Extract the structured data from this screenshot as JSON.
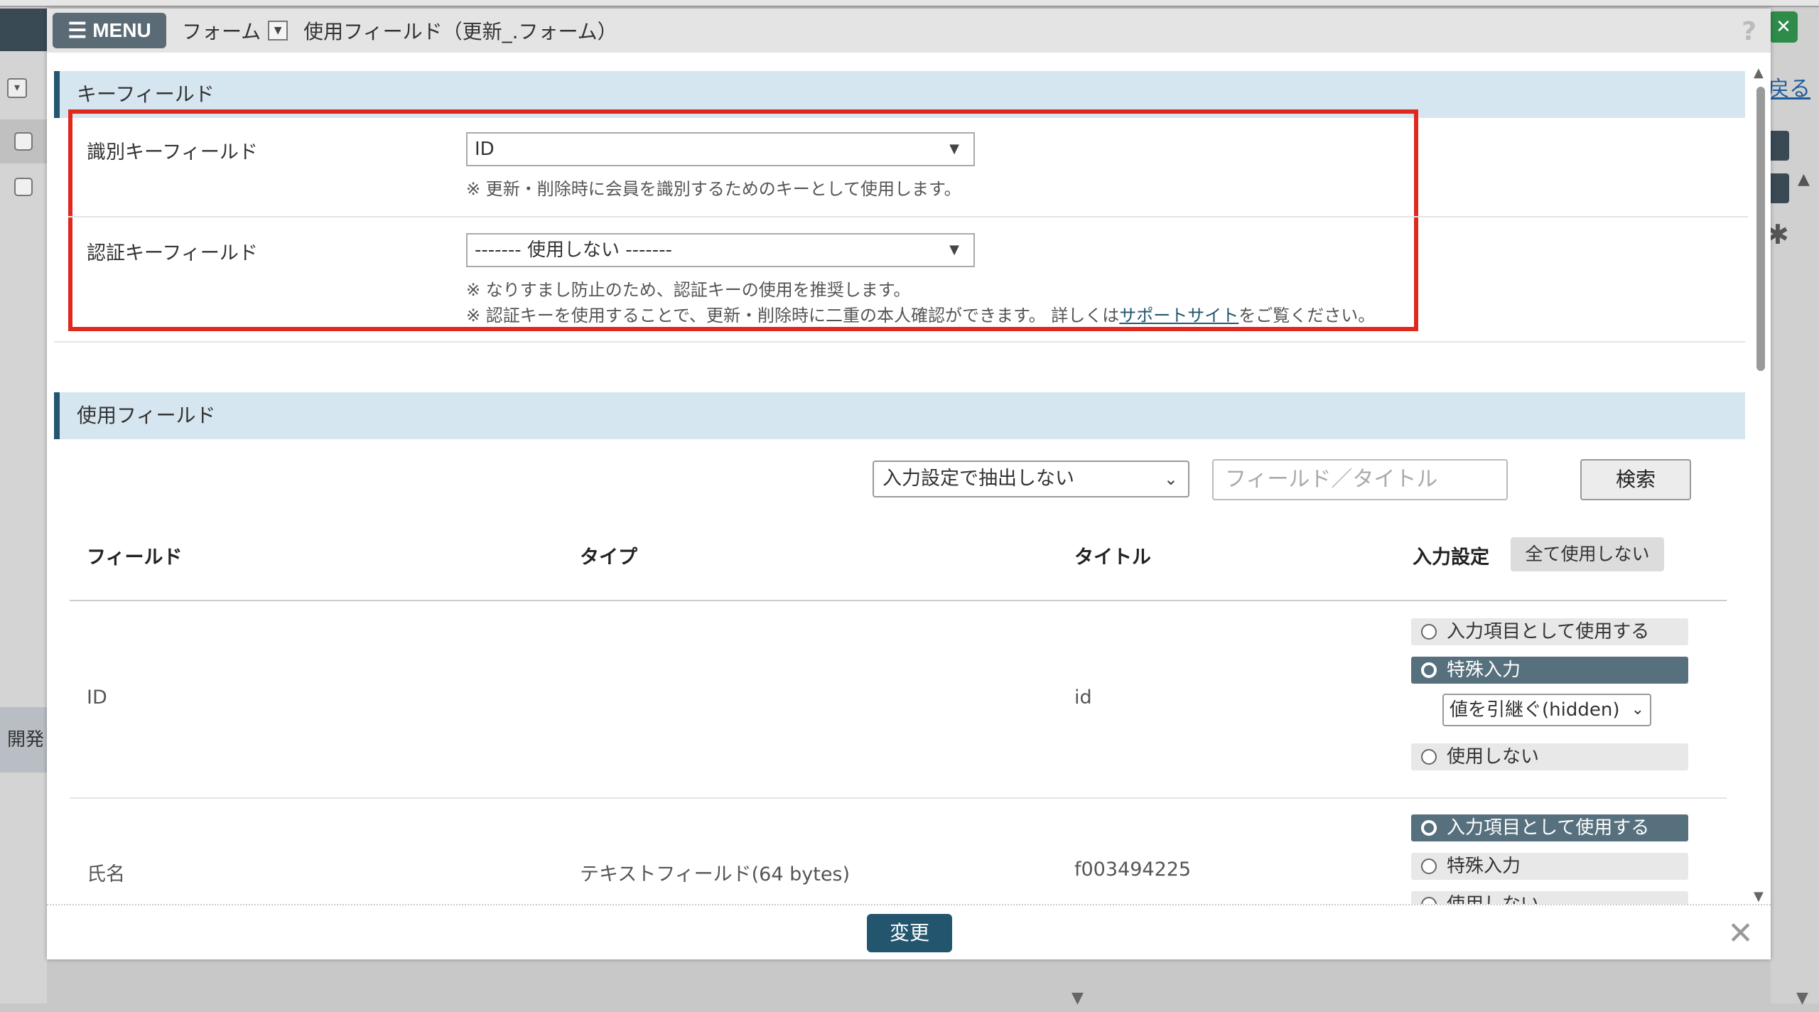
{
  "header": {
    "menu_label": "MENU",
    "breadcrumb_form": "フォーム",
    "page_title": "使用フィールド（更新_.フォーム）",
    "help_symbol": "?"
  },
  "background": {
    "right_link": "戻る",
    "left_label": "開発"
  },
  "key_section": {
    "title": "キーフィールド",
    "id_field_label": "識別キーフィールド",
    "id_field_value": "ID",
    "id_field_note": "※ 更新・削除時に会員を識別するためのキーとして使用します。",
    "auth_field_label": "認証キーフィールド",
    "auth_field_value": "------- 使用しない -------",
    "auth_note_1": "※ なりすまし防止のため、認証キーの使用を推奨します。",
    "auth_note_2_pre": "※ 認証キーを使用することで、更新・削除時に二重の本人確認ができます。 詳しくは",
    "auth_note_2_link": "サポートサイト",
    "auth_note_2_post": "をご覧ください。"
  },
  "fields_section": {
    "title": "使用フィールド",
    "filter_value": "入力設定で抽出しない",
    "search_placeholder": "フィールド／タイトル",
    "search_button": "検索",
    "columns": {
      "field": "フィールド",
      "type": "タイプ",
      "title": "タイトル",
      "input": "入力設定"
    },
    "all_off_button": "全て使用しない",
    "rows": [
      {
        "field": "ID",
        "type": "",
        "title": "id",
        "options": [
          "入力項目として使用する",
          "特殊入力",
          "使用しない"
        ],
        "selected": "特殊入力",
        "special_value": "値を引継ぐ(hidden)"
      },
      {
        "field": "氏名",
        "type": "テキストフィールド(64 bytes)",
        "title": "f003494225",
        "options": [
          "入力項目として使用する",
          "特殊入力",
          "使用しない"
        ],
        "selected": "入力項目として使用する"
      }
    ]
  },
  "footer": {
    "change_button": "変更",
    "close_symbol": "✕"
  },
  "colors": {
    "accent": "#23566e",
    "highlight_border": "#e0281c",
    "section_bg": "#d6e6f0",
    "selected_radio": "#57707e"
  }
}
